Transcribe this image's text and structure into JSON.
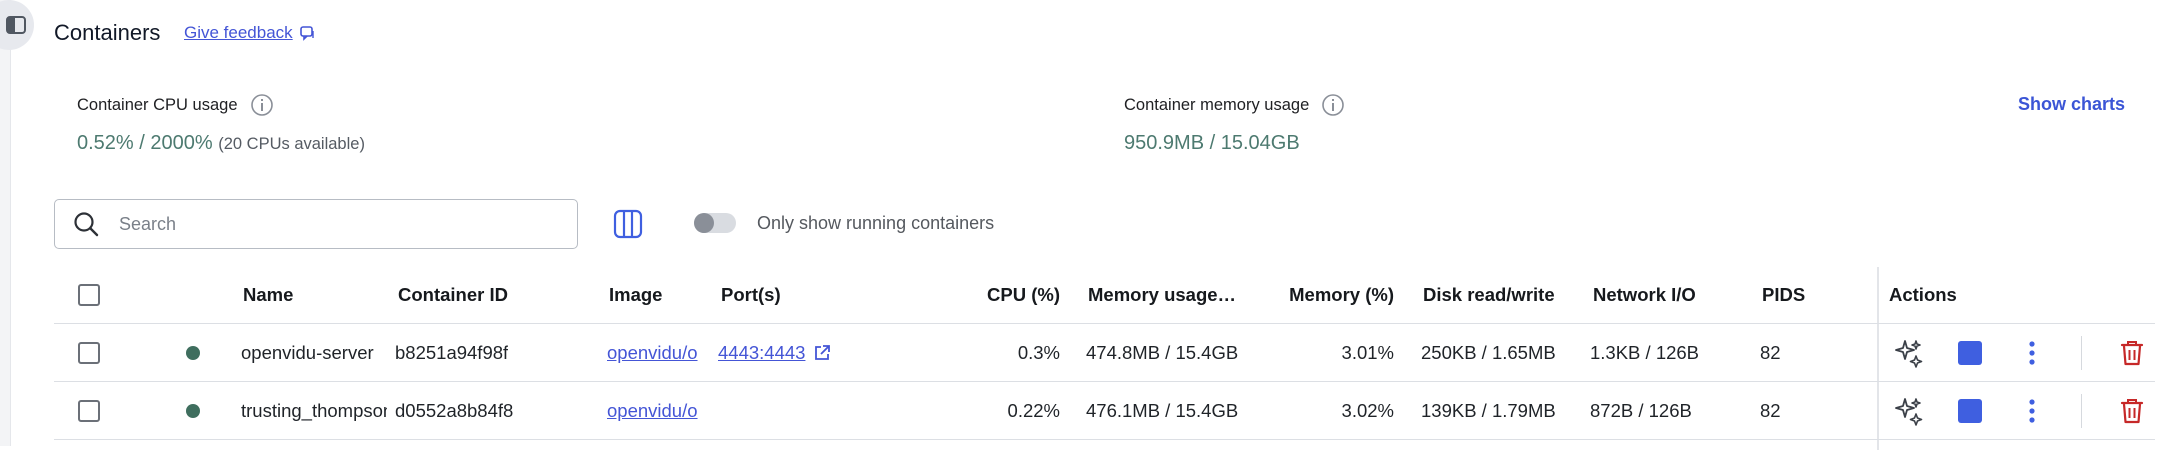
{
  "header": {
    "title": "Containers",
    "feedback_label": "Give feedback"
  },
  "stats": {
    "cpu_label": "Container CPU usage",
    "cpu_value": "0.52% / 2000%",
    "cpu_sub": "(20 CPUs available)",
    "memory_label": "Container memory usage",
    "memory_value": "950.9MB / 15.04GB",
    "show_charts": "Show charts"
  },
  "toolbar": {
    "search_placeholder": "Search",
    "search_value": "",
    "only_running_label": "Only show running containers",
    "only_running_on": false
  },
  "table": {
    "headers": {
      "name": "Name",
      "container_id": "Container ID",
      "image": "Image",
      "ports": "Port(s)",
      "cpu": "CPU (%)",
      "memory_usage": "Memory usage…",
      "memory_pct": "Memory (%)",
      "disk": "Disk read/write",
      "network": "Network I/O",
      "pids": "PIDS",
      "actions": "Actions"
    },
    "rows": [
      {
        "status": "running",
        "name": "openvidu-server",
        "container_id": "b8251a94f98f",
        "image": "openvidu/o",
        "ports": "4443:4443",
        "cpu": "0.3%",
        "memory_usage": "474.8MB / 15.4GB",
        "memory_pct": "3.01%",
        "disk": "250KB / 1.65MB",
        "network": "1.3KB / 126B",
        "pids": "82"
      },
      {
        "status": "running",
        "name": "trusting_thompson",
        "container_id": "d0552a8b84f8",
        "image": "openvidu/o",
        "ports": "",
        "cpu": "0.22%",
        "memory_usage": "476.1MB / 15.4GB",
        "memory_pct": "3.02%",
        "disk": "139KB / 1.79MB",
        "network": "872B / 126B",
        "pids": "82"
      }
    ]
  },
  "icons": {
    "sidebar": "sidebar-toggle-icon",
    "feedback": "chat-bubble-icon",
    "info": "info-icon",
    "search": "search-icon",
    "columns": "columns-icon",
    "external": "external-link-icon",
    "ai": "sparkles-icon",
    "stop": "stop-icon",
    "more": "kebab-menu-icon",
    "delete": "trash-icon"
  },
  "colors": {
    "accent": "#4455d6",
    "stat_value": "#4d7a70",
    "status_running": "#3f6e5e",
    "delete": "#c62828"
  }
}
